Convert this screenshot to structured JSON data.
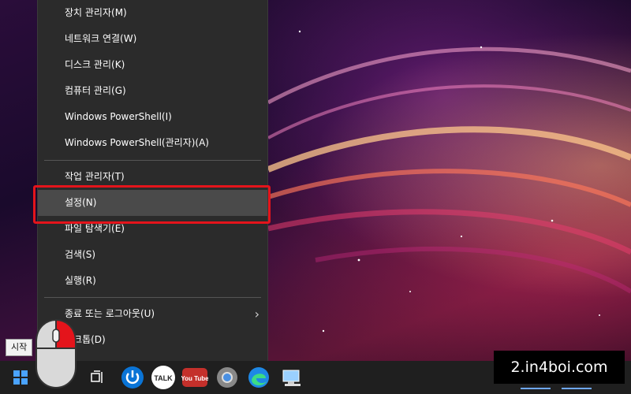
{
  "menu": {
    "items": [
      {
        "label": "장치 관리자(M)"
      },
      {
        "label": "네트워크 연결(W)"
      },
      {
        "label": "디스크 관리(K)"
      },
      {
        "label": "컴퓨터 관리(G)"
      },
      {
        "label": "Windows PowerShell(I)"
      },
      {
        "label": "Windows PowerShell(관리자)(A)"
      },
      {
        "label": "작업 관리자(T)"
      },
      {
        "label": "설정(N)"
      },
      {
        "label": "파일 탐색기(E)"
      },
      {
        "label": "검색(S)"
      },
      {
        "label": "실행(R)"
      },
      {
        "label": "종료 또는 로그아웃(U)",
        "submenu_icon": "chevron-right-icon"
      },
      {
        "label": "스크톱(D)"
      }
    ],
    "highlighted_item": "설정(N)"
  },
  "tooltip": {
    "text": "시작"
  },
  "watermark": {
    "text": "2.in4boi.com"
  },
  "taskbar": {
    "icons": [
      "windows-start-icon",
      "task-view-icon",
      "power-app-icon",
      "kakaotalk-icon",
      "youtube-icon",
      "chrome-icon",
      "edge-icon",
      "network-pc-icon"
    ],
    "kakao_label": "TALK",
    "youtube_label": "You Tube"
  },
  "colors": {
    "accent_red": "#e4141b",
    "menu_bg": "#2b2b2b"
  }
}
